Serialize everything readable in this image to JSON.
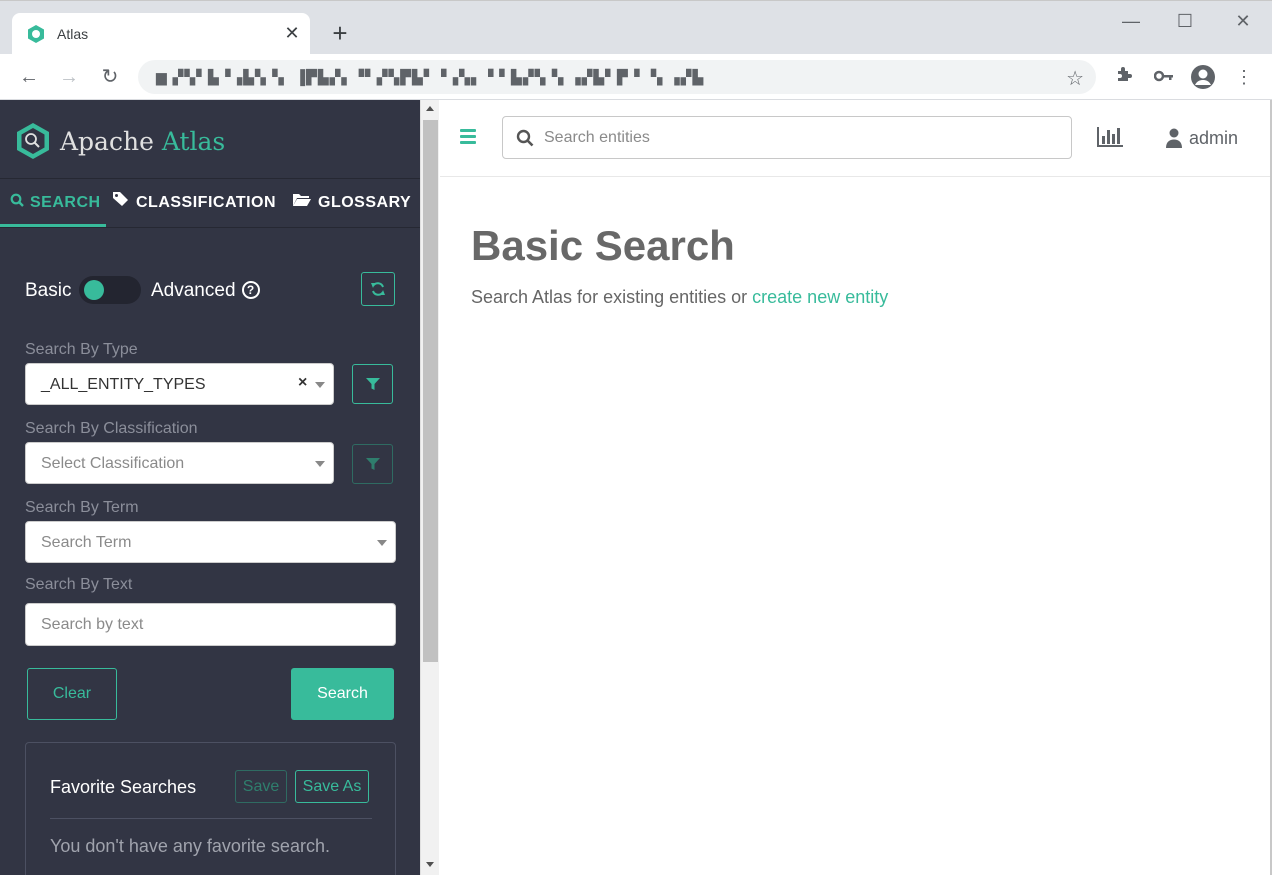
{
  "browser": {
    "tab_title": "Atlas",
    "url": "▆ ▞▚▘▙▝▗▙▚▝▖ ▐▛▙▞▖▝▘▞▚▛▙▘▝▗▚▖▝ ▘▙▞▚▝▖▗▞▙▘▛▝ ▝▖▗▞▙",
    "icons": [
      "back-icon",
      "forward-icon",
      "reload-icon",
      "star-icon",
      "extensions-icon",
      "key-icon",
      "profile-icon",
      "menu-icon"
    ]
  },
  "sidebar": {
    "logo": {
      "part1": "Apache",
      "part2": "Atlas"
    },
    "tabs": [
      {
        "label": "SEARCH",
        "active": true
      },
      {
        "label": "CLASSIFICATION",
        "active": false
      },
      {
        "label": "GLOSSARY",
        "active": false
      }
    ],
    "mode": {
      "basic": "Basic",
      "advanced": "Advanced",
      "help": "?"
    },
    "search_by_type": {
      "label": "Search By Type",
      "value": "_ALL_ENTITY_TYPES",
      "clear": "×"
    },
    "search_by_classification": {
      "label": "Search By Classification",
      "placeholder": "Select Classification"
    },
    "search_by_term": {
      "label": "Search By Term",
      "placeholder": "Search Term"
    },
    "search_by_text": {
      "label": "Search By Text",
      "placeholder": "Search by text"
    },
    "clear_button": "Clear",
    "search_button": "Search",
    "favorites": {
      "title": "Favorite Searches",
      "save": "Save",
      "save_as": "Save As",
      "empty": "You don't have any favorite search."
    }
  },
  "header": {
    "search_placeholder": "Search entities",
    "user": "admin"
  },
  "main": {
    "title": "Basic Search",
    "subtitle": "Search Atlas for existing entities or",
    "link": "create new entity"
  },
  "colors": {
    "accent": "#38bb9b",
    "sidebar_bg": "#323544"
  }
}
